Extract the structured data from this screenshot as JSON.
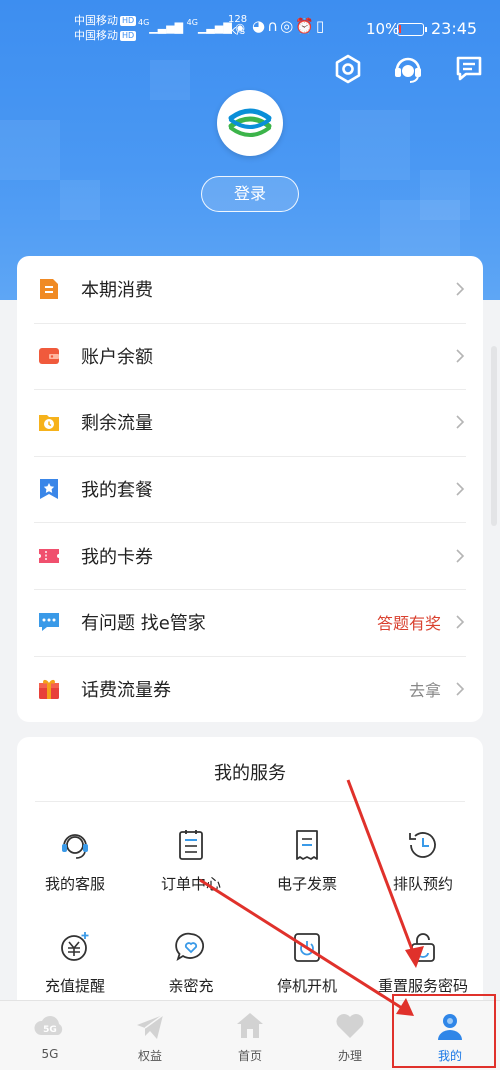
{
  "status_bar": {
    "carrier_1": "中国移动",
    "carrier_2": "中国移动",
    "hd_badge": "HD",
    "network_1": "4G",
    "network_2": "4G",
    "speed_value": "128",
    "speed_unit": "K/s",
    "battery_percent": "10%",
    "battery_level": 0.1,
    "time": "23:45"
  },
  "header": {
    "icons": [
      "settings-icon",
      "customer-service-icon",
      "message-icon"
    ],
    "logo": "china-mobile-logo",
    "login_label": "登录"
  },
  "menu": {
    "items": [
      {
        "label": "本期消费",
        "extra": "",
        "icon": "bill-icon",
        "color": "#f08a24"
      },
      {
        "label": "账户余额",
        "extra": "",
        "icon": "wallet-icon",
        "color": "#f05a3c"
      },
      {
        "label": "剩余流量",
        "extra": "",
        "icon": "folder-clock-icon",
        "color": "#f6b21b"
      },
      {
        "label": "我的套餐",
        "extra": "",
        "icon": "bookmark-star-icon",
        "color": "#3a86e8"
      },
      {
        "label": "我的卡券",
        "extra": "",
        "icon": "ticket-icon",
        "color": "#f0506e"
      },
      {
        "label": "有问题 找e管家",
        "extra": "答题有奖",
        "icon": "chat-bubble-icon",
        "color": "#3a9ae8"
      },
      {
        "label": "话费流量券",
        "extra": "去拿",
        "icon": "gift-icon",
        "color": "#e8403a"
      }
    ],
    "extra_colors": {
      "highlight": "#d9412f",
      "muted": "#888888"
    }
  },
  "services": {
    "title": "我的服务",
    "items": [
      {
        "label": "我的客服",
        "icon": "headset-icon"
      },
      {
        "label": "订单中心",
        "icon": "order-list-icon"
      },
      {
        "label": "电子发票",
        "icon": "receipt-icon"
      },
      {
        "label": "排队预约",
        "icon": "clock-icon"
      },
      {
        "label": "充值提醒",
        "icon": "yuan-coin-icon"
      },
      {
        "label": "亲密充",
        "icon": "heart-bubble-icon"
      },
      {
        "label": "停机开机",
        "icon": "power-icon"
      },
      {
        "label": "重置服务密码",
        "icon": "lock-icon"
      }
    ]
  },
  "tabbar": {
    "tabs": [
      {
        "label": "5G",
        "icon": "5g-cloud-icon",
        "active": false
      },
      {
        "label": "权益",
        "icon": "paper-plane-icon",
        "active": false
      },
      {
        "label": "首页",
        "icon": "home-icon",
        "active": false
      },
      {
        "label": "办理",
        "icon": "heart-icon",
        "active": false
      },
      {
        "label": "我的",
        "icon": "user-avatar-icon",
        "active": true
      }
    ]
  },
  "colors": {
    "header_blue": "#3d8ef0",
    "accent_blue": "#1877e6",
    "annotation_red": "#e0312b"
  }
}
